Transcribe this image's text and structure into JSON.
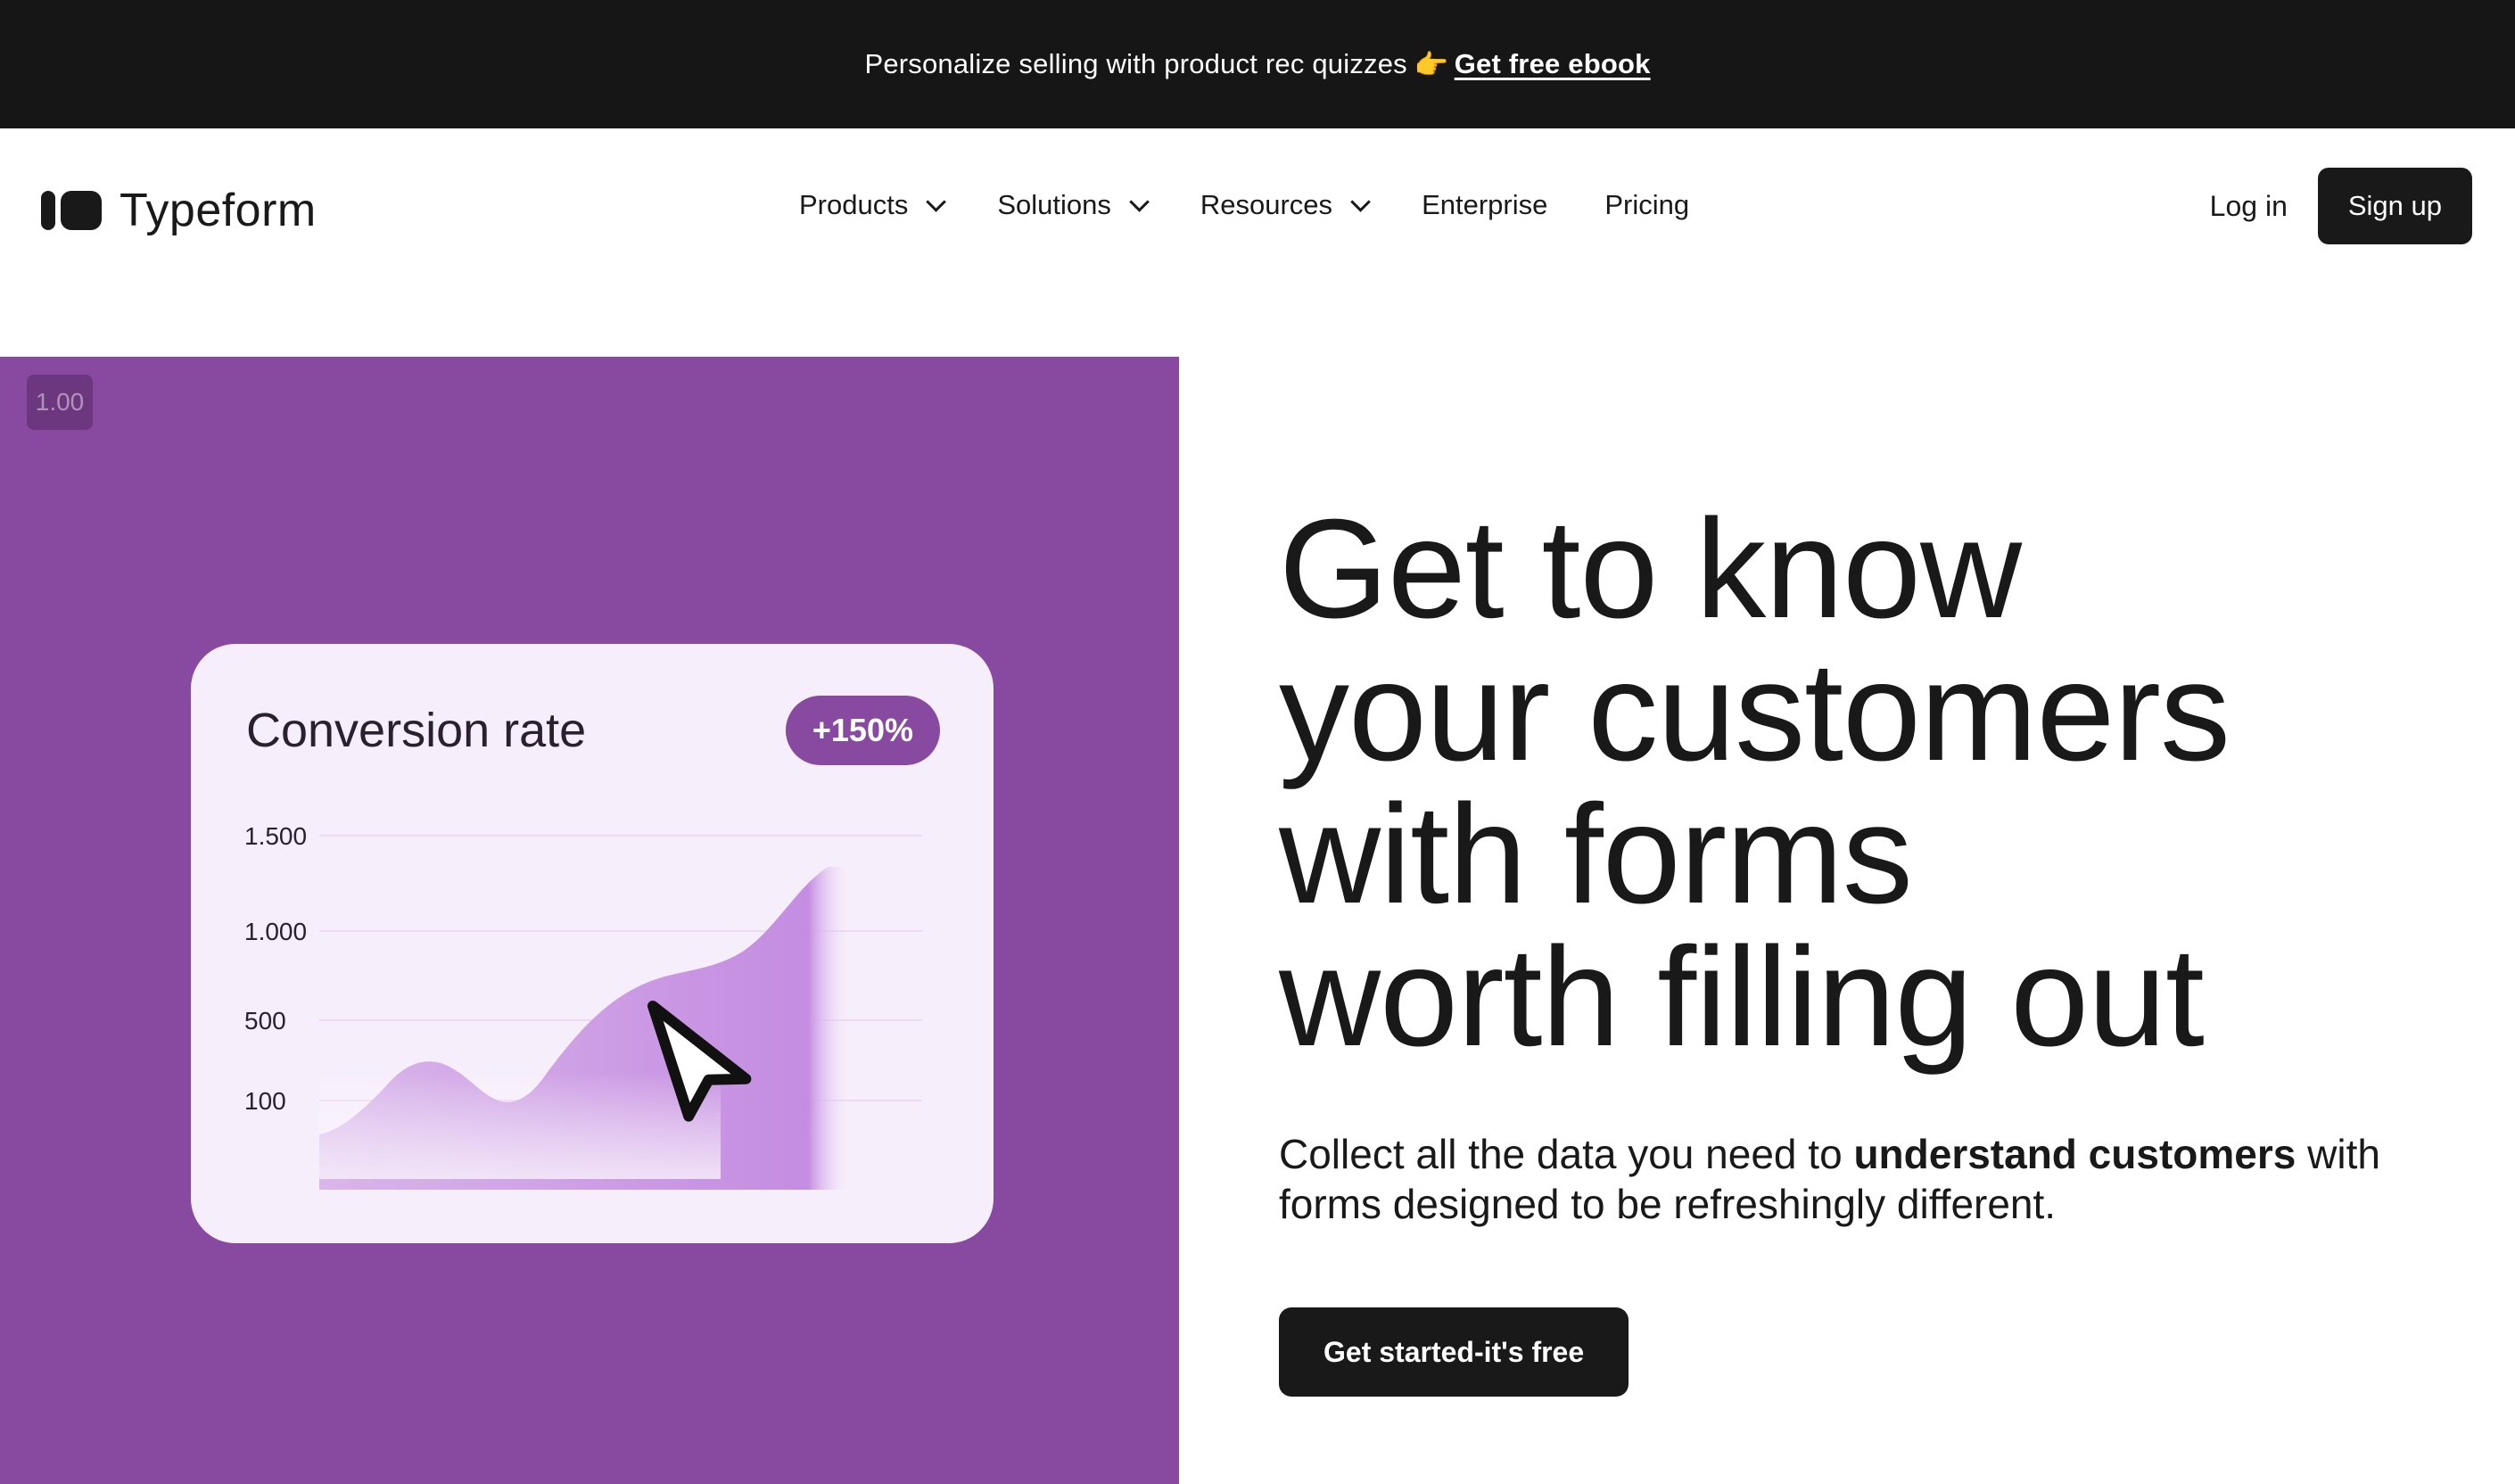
{
  "announcement": {
    "text": "Personalize selling with product rec quizzes",
    "emoji": "👉",
    "link_label": "Get free ebook"
  },
  "nav": {
    "logo_text": "Typeform",
    "menu": [
      {
        "label": "Products",
        "has_dropdown": true
      },
      {
        "label": "Solutions",
        "has_dropdown": true
      },
      {
        "label": "Resources",
        "has_dropdown": true
      },
      {
        "label": "Enterprise",
        "has_dropdown": false
      },
      {
        "label": "Pricing",
        "has_dropdown": false
      }
    ],
    "login_label": "Log in",
    "signup_label": "Sign up"
  },
  "hero": {
    "playback_speed": "1.00",
    "title_lines": [
      "Get to know",
      "your customers",
      "with forms",
      "worth filling out"
    ],
    "subtitle_pre": "Collect all the data you need to ",
    "subtitle_bold": "understand customers",
    "subtitle_post": " with forms designed to be refreshingly different.",
    "cta_label": "Get started-it's free",
    "panel_color": "#874aa0"
  },
  "card": {
    "title": "Conversion rate",
    "badge": "+150%",
    "y_ticks": [
      "1.500",
      "1.000",
      "500",
      "100"
    ]
  },
  "chart_data": {
    "type": "area",
    "title": "Conversion rate",
    "yticks": [
      "1.500",
      "1.000",
      "500",
      "100"
    ],
    "y_values_ticks": [
      1500,
      1000,
      500,
      100
    ],
    "annotation": "+150%",
    "series_points_normalized_x": [
      0,
      0.12,
      0.23,
      0.35,
      0.48,
      0.62,
      0.78,
      1.0
    ],
    "series_values": [
      20,
      280,
      60,
      480,
      800,
      840,
      900,
      1520
    ],
    "colors": {
      "fill": "#c89ae0",
      "line": "#b77fd8"
    }
  }
}
